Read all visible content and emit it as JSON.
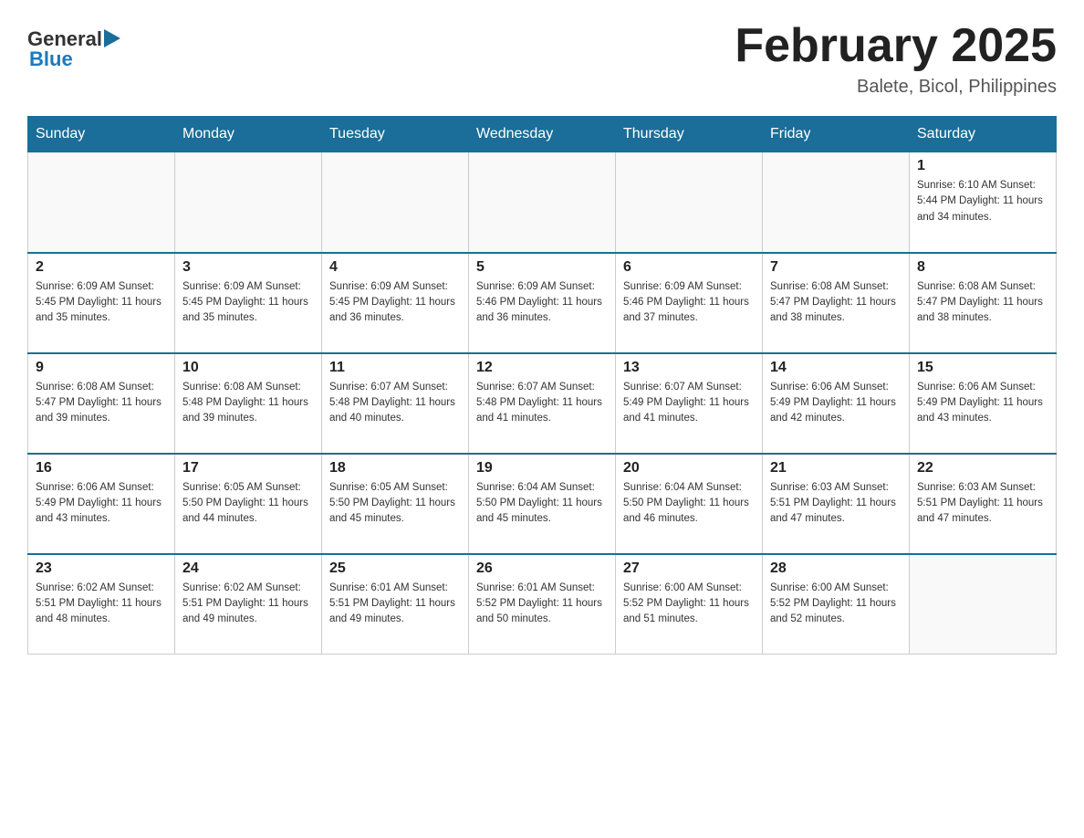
{
  "header": {
    "logo": {
      "general_text": "General",
      "blue_text": "Blue"
    },
    "title": "February 2025",
    "subtitle": "Balete, Bicol, Philippines"
  },
  "days_of_week": [
    "Sunday",
    "Monday",
    "Tuesday",
    "Wednesday",
    "Thursday",
    "Friday",
    "Saturday"
  ],
  "weeks": [
    [
      {
        "day": "",
        "info": ""
      },
      {
        "day": "",
        "info": ""
      },
      {
        "day": "",
        "info": ""
      },
      {
        "day": "",
        "info": ""
      },
      {
        "day": "",
        "info": ""
      },
      {
        "day": "",
        "info": ""
      },
      {
        "day": "1",
        "info": "Sunrise: 6:10 AM\nSunset: 5:44 PM\nDaylight: 11 hours\nand 34 minutes."
      }
    ],
    [
      {
        "day": "2",
        "info": "Sunrise: 6:09 AM\nSunset: 5:45 PM\nDaylight: 11 hours\nand 35 minutes."
      },
      {
        "day": "3",
        "info": "Sunrise: 6:09 AM\nSunset: 5:45 PM\nDaylight: 11 hours\nand 35 minutes."
      },
      {
        "day": "4",
        "info": "Sunrise: 6:09 AM\nSunset: 5:45 PM\nDaylight: 11 hours\nand 36 minutes."
      },
      {
        "day": "5",
        "info": "Sunrise: 6:09 AM\nSunset: 5:46 PM\nDaylight: 11 hours\nand 36 minutes."
      },
      {
        "day": "6",
        "info": "Sunrise: 6:09 AM\nSunset: 5:46 PM\nDaylight: 11 hours\nand 37 minutes."
      },
      {
        "day": "7",
        "info": "Sunrise: 6:08 AM\nSunset: 5:47 PM\nDaylight: 11 hours\nand 38 minutes."
      },
      {
        "day": "8",
        "info": "Sunrise: 6:08 AM\nSunset: 5:47 PM\nDaylight: 11 hours\nand 38 minutes."
      }
    ],
    [
      {
        "day": "9",
        "info": "Sunrise: 6:08 AM\nSunset: 5:47 PM\nDaylight: 11 hours\nand 39 minutes."
      },
      {
        "day": "10",
        "info": "Sunrise: 6:08 AM\nSunset: 5:48 PM\nDaylight: 11 hours\nand 39 minutes."
      },
      {
        "day": "11",
        "info": "Sunrise: 6:07 AM\nSunset: 5:48 PM\nDaylight: 11 hours\nand 40 minutes."
      },
      {
        "day": "12",
        "info": "Sunrise: 6:07 AM\nSunset: 5:48 PM\nDaylight: 11 hours\nand 41 minutes."
      },
      {
        "day": "13",
        "info": "Sunrise: 6:07 AM\nSunset: 5:49 PM\nDaylight: 11 hours\nand 41 minutes."
      },
      {
        "day": "14",
        "info": "Sunrise: 6:06 AM\nSunset: 5:49 PM\nDaylight: 11 hours\nand 42 minutes."
      },
      {
        "day": "15",
        "info": "Sunrise: 6:06 AM\nSunset: 5:49 PM\nDaylight: 11 hours\nand 43 minutes."
      }
    ],
    [
      {
        "day": "16",
        "info": "Sunrise: 6:06 AM\nSunset: 5:49 PM\nDaylight: 11 hours\nand 43 minutes."
      },
      {
        "day": "17",
        "info": "Sunrise: 6:05 AM\nSunset: 5:50 PM\nDaylight: 11 hours\nand 44 minutes."
      },
      {
        "day": "18",
        "info": "Sunrise: 6:05 AM\nSunset: 5:50 PM\nDaylight: 11 hours\nand 45 minutes."
      },
      {
        "day": "19",
        "info": "Sunrise: 6:04 AM\nSunset: 5:50 PM\nDaylight: 11 hours\nand 45 minutes."
      },
      {
        "day": "20",
        "info": "Sunrise: 6:04 AM\nSunset: 5:50 PM\nDaylight: 11 hours\nand 46 minutes."
      },
      {
        "day": "21",
        "info": "Sunrise: 6:03 AM\nSunset: 5:51 PM\nDaylight: 11 hours\nand 47 minutes."
      },
      {
        "day": "22",
        "info": "Sunrise: 6:03 AM\nSunset: 5:51 PM\nDaylight: 11 hours\nand 47 minutes."
      }
    ],
    [
      {
        "day": "23",
        "info": "Sunrise: 6:02 AM\nSunset: 5:51 PM\nDaylight: 11 hours\nand 48 minutes."
      },
      {
        "day": "24",
        "info": "Sunrise: 6:02 AM\nSunset: 5:51 PM\nDaylight: 11 hours\nand 49 minutes."
      },
      {
        "day": "25",
        "info": "Sunrise: 6:01 AM\nSunset: 5:51 PM\nDaylight: 11 hours\nand 49 minutes."
      },
      {
        "day": "26",
        "info": "Sunrise: 6:01 AM\nSunset: 5:52 PM\nDaylight: 11 hours\nand 50 minutes."
      },
      {
        "day": "27",
        "info": "Sunrise: 6:00 AM\nSunset: 5:52 PM\nDaylight: 11 hours\nand 51 minutes."
      },
      {
        "day": "28",
        "info": "Sunrise: 6:00 AM\nSunset: 5:52 PM\nDaylight: 11 hours\nand 52 minutes."
      },
      {
        "day": "",
        "info": ""
      }
    ]
  ]
}
